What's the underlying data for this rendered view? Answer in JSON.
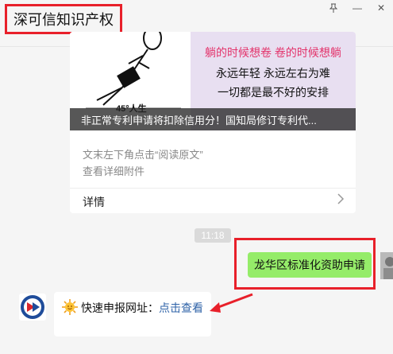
{
  "header": {
    "title": "深可信知识产权"
  },
  "window_controls": {
    "pin_icon": "pin-icon",
    "minimize_label": "—",
    "close_label": "✕"
  },
  "article_card": {
    "image_lines": [
      "躺的时候想卷 卷的时候想躺",
      "永远年轻 永远左右为难",
      "一切都是最不好的安排"
    ],
    "stick_caption": "45°人生",
    "overlay_title": "非正常专利申请将扣除信用分！国知局修订专利代...",
    "hint_line1": "文末左下角点击“阅读原文”",
    "hint_line2": "查看详细附件",
    "details_label": "详情",
    "details_icon": "chevron-right-icon"
  },
  "timestamp": "11:18",
  "sent_message": {
    "text": "龙华区标准化资助申请"
  },
  "received_message": {
    "prefix": "快速申报网址：",
    "link": "点击查看",
    "emoji": "sun-emoji"
  },
  "colors": {
    "highlight": "#e8202a",
    "sent_bubble": "#95ec69",
    "link": "#2f63a8"
  }
}
